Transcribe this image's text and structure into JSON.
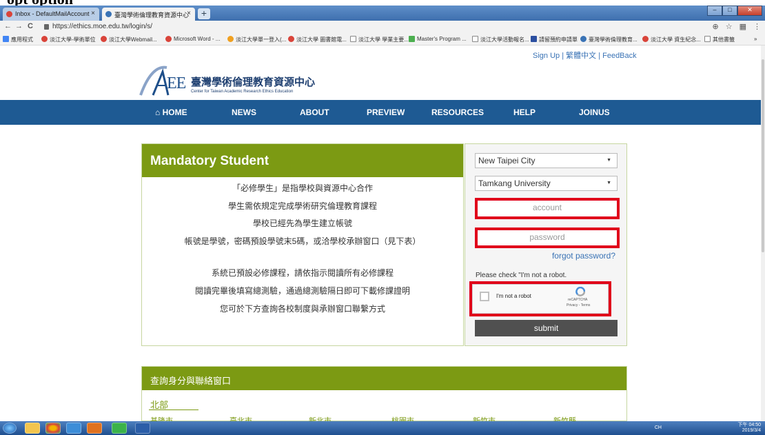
{
  "caption": "opt option",
  "browser": {
    "tabs": [
      {
        "title": "Inbox - DefaultMailAccount",
        "close": "×"
      },
      {
        "title": "臺灣學術倫理教育資源中心",
        "close": "×"
      }
    ],
    "new_tab": "+",
    "window_buttons": {
      "min": "–",
      "max": "□",
      "close": "✕"
    },
    "nav": {
      "back": "←",
      "forward": "→",
      "reload": "C"
    },
    "url": "https://ethics.moe.edu.tw/login/s/",
    "right_icons": {
      "zoom": "⊕",
      "star": "☆",
      "ext": "▦",
      "menu": "⋮"
    },
    "bookmarks": [
      "應用程式",
      "淡江大學-學術單位",
      "淡江大學Webmail...",
      "Microsoft Word - ...",
      "淡江大學單一登入(...",
      "淡江大學 圖書館電...",
      "淡江大學 學業主要...",
      "Master's Program ...",
      "淡江大學活動報名...",
      "請留預約申請單",
      "臺灣學術倫理教育...",
      "淡江大學 資生紀念...",
      "其他書籤"
    ],
    "bookmarks_more": "»"
  },
  "header": {
    "signup": "Sign Up",
    "sep1": "|",
    "lang": "繁體中文",
    "sep2": "|",
    "feedback": "FeedBack",
    "logo_mark": "AREE",
    "logo_title": "臺灣學術倫理教育資源中心",
    "logo_subtitle": "Center for Taiwan Academic Research Ethics Education"
  },
  "nav": [
    {
      "label": "HOME",
      "icon": "home-icon"
    },
    {
      "label": "NEWS"
    },
    {
      "label": "ABOUT"
    },
    {
      "label": "PREVIEW"
    },
    {
      "label": "RESOURCES"
    },
    {
      "label": "HELP"
    },
    {
      "label": "JOINUS"
    }
  ],
  "mandatory": {
    "title": "Mandatory Student",
    "lines": [
      "「必修學生」是指學校與資源中心合作",
      "學生需依規定完成學術研究倫理教育課程",
      "學校已經先為學生建立帳號",
      "帳號是學號，密碼預設學號末5碼，或洽學校承辦窗口（見下表）",
      "系統已預設必修課程，請依指示閱讀所有必修課程",
      "閱讀完畢後填寫總測驗，通過總測驗隔日即可下載修課證明",
      "您可於下方查詢各校制度與承辦窗口聯繫方式"
    ]
  },
  "login": {
    "city": "New Taipei City",
    "school": "Tamkang University",
    "account_placeholder": "account",
    "password_placeholder": "password",
    "forgot": "forgot password?",
    "check_label": "Please check \"I'm not a robot.",
    "recaptcha_label": "I'm not a robot",
    "recaptcha_brand": "reCAPTCHA",
    "recaptcha_terms": "Privacy - Terms",
    "submit": "submit",
    "highlight_color": "#e0001a"
  },
  "lookup": {
    "title": "查詢身分與聯絡窗口",
    "region": "北部",
    "cities": [
      "基隆市",
      "臺北市",
      "新北市",
      "桃園市",
      "新竹市",
      "新竹縣"
    ]
  },
  "taskbar": {
    "time": "下午 04:50",
    "date": "2019/3/4",
    "tray": "CH"
  },
  "colors": {
    "nav": "#1e5a93",
    "card_head": "#7c9a13",
    "link": "#3a73b5",
    "submit": "#505050"
  }
}
